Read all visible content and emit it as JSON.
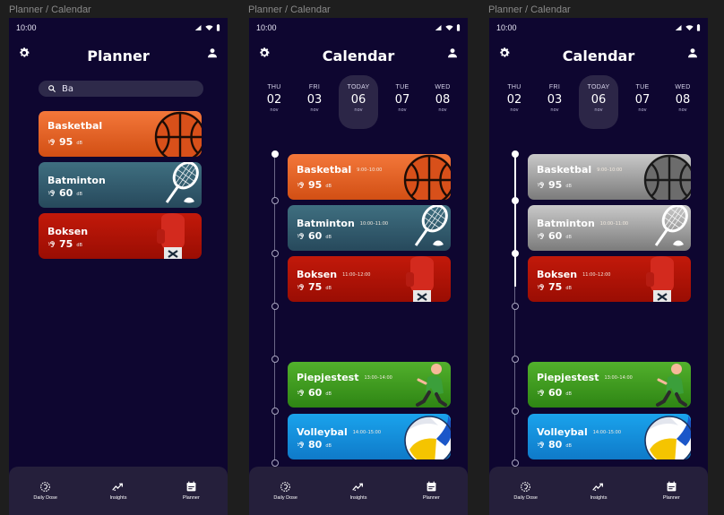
{
  "frames": [
    {
      "label": "Planner / Calendar"
    },
    {
      "label": "Planner / Calendar"
    },
    {
      "label": "Planner / Calendar"
    }
  ],
  "status": {
    "time": "10:00"
  },
  "planner": {
    "title": "Planner",
    "search_value": "Ba",
    "cards": [
      {
        "name": "Basketbal",
        "value": "95",
        "unit": "dB"
      },
      {
        "name": "Batminton",
        "value": "60",
        "unit": "dB"
      },
      {
        "name": "Boksen",
        "value": "75",
        "unit": "dB"
      }
    ]
  },
  "calendar": {
    "title": "Calendar",
    "days": [
      {
        "name": "THU",
        "date": "02",
        "month": "nov"
      },
      {
        "name": "FRI",
        "date": "03",
        "month": "nov"
      },
      {
        "name": "TODAY",
        "date": "06",
        "month": "nov"
      },
      {
        "name": "TUE",
        "date": "07",
        "month": "nov"
      },
      {
        "name": "WED",
        "date": "08",
        "month": "nov"
      }
    ],
    "cards": [
      {
        "name": "Basketbal",
        "time": "9:00–10:00",
        "value": "95",
        "unit": "dB"
      },
      {
        "name": "Batminton",
        "time": "10:00–11:00",
        "value": "60",
        "unit": "dB"
      },
      {
        "name": "Boksen",
        "time": "11:00–12:00",
        "value": "75",
        "unit": "dB"
      },
      {
        "name": "Piepjestest",
        "time": "13:00–14:00",
        "value": "60",
        "unit": "dB"
      },
      {
        "name": "Volleybal",
        "time": "14:00–15:00",
        "value": "80",
        "unit": "dB"
      }
    ]
  },
  "nav": {
    "items": [
      {
        "label": "Daily Dose",
        "icon": "daily-dose-icon"
      },
      {
        "label": "Insights",
        "icon": "insights-icon"
      },
      {
        "label": "Planner",
        "icon": "planner-icon"
      }
    ]
  },
  "colors": {
    "background": "#0e0630",
    "basketball": "#e8642a",
    "badminton": "#34606f",
    "boxing": "#b11406",
    "hearing_test": "#45a022",
    "volleyball": "#1592de",
    "past_grey": "#a5a5a5"
  }
}
